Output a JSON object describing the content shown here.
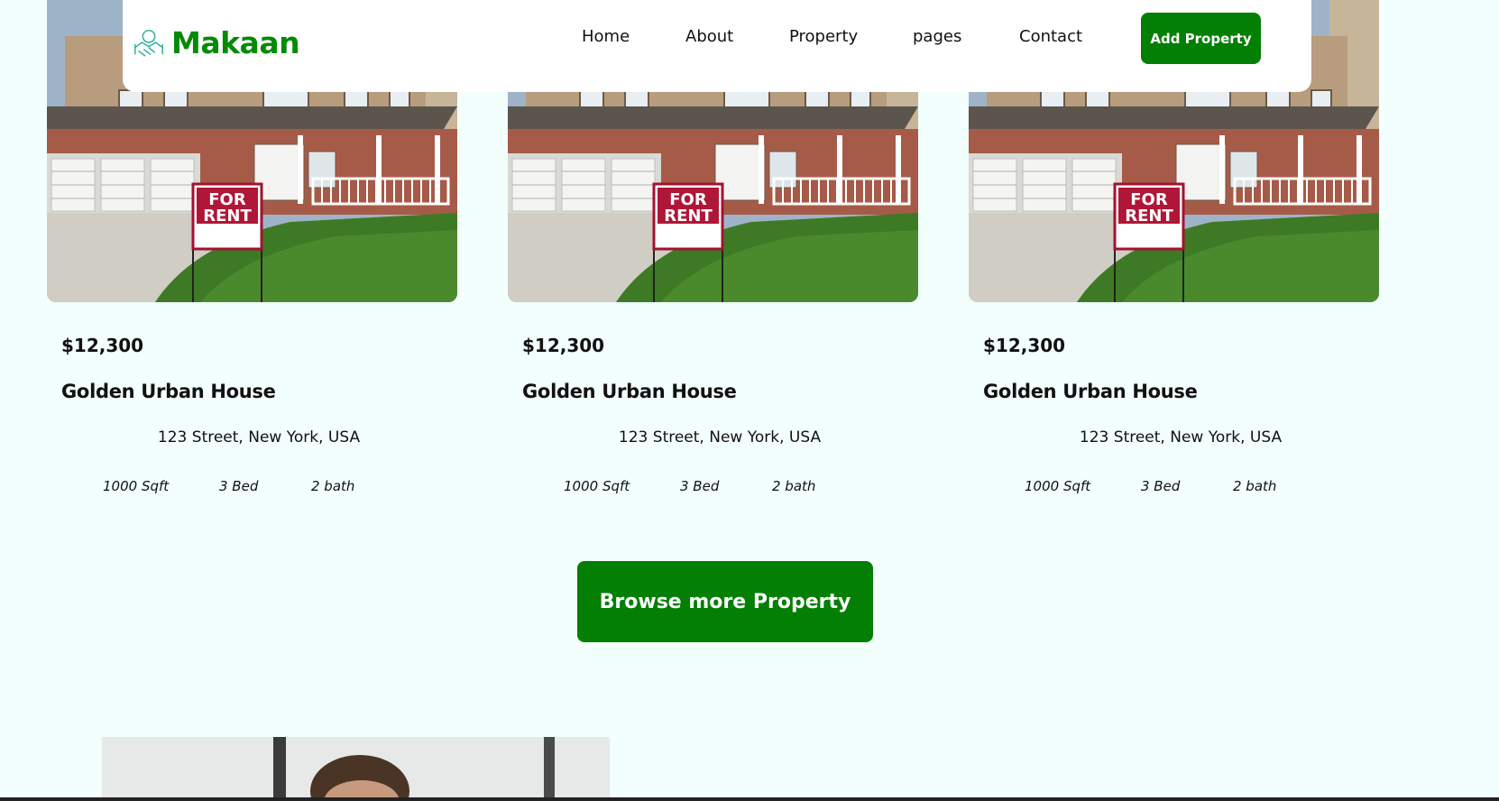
{
  "brand": {
    "name": "Makaan",
    "color": "#058a05"
  },
  "nav": {
    "items": [
      {
        "label": "Home"
      },
      {
        "label": "About"
      },
      {
        "label": "Property"
      },
      {
        "label": "pages"
      },
      {
        "label": "Contact"
      }
    ],
    "cta_label": "Add Property"
  },
  "properties": [
    {
      "image_sign": "FOR RENT",
      "price": "$12,300",
      "title": "Golden Urban House",
      "address": "123 Street, New York, USA",
      "area": "1000 Sqft",
      "beds": "3 Bed",
      "baths": "2 bath"
    },
    {
      "image_sign": "FOR RENT",
      "price": "$12,300",
      "title": "Golden Urban House",
      "address": "123 Street, New York, USA",
      "area": "1000 Sqft",
      "beds": "3 Bed",
      "baths": "2 bath"
    },
    {
      "image_sign": "FOR RENT",
      "price": "$12,300",
      "title": "Golden Urban House",
      "address": "123 Street, New York, USA",
      "area": "1000 Sqft",
      "beds": "3 Bed",
      "baths": "2 bath"
    }
  ],
  "browse_button_label": "Browse more Property",
  "colors": {
    "accent": "#037f03",
    "page_background": "#f2fffd"
  }
}
